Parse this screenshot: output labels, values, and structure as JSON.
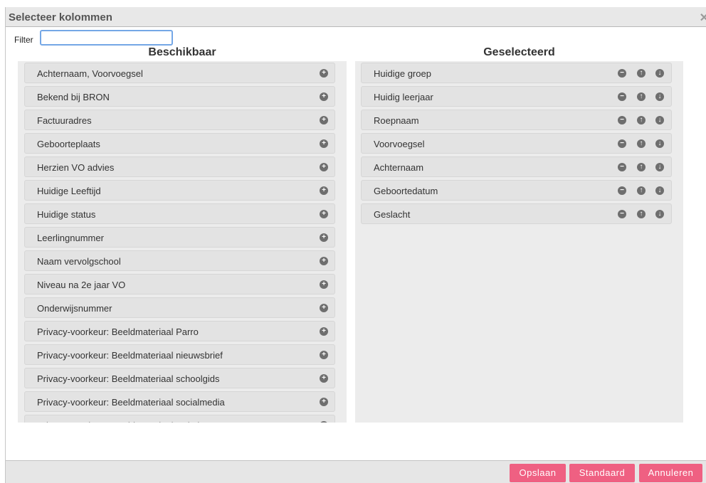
{
  "dialog": {
    "title": "Selecteer kolommen",
    "close_symbol": "✕"
  },
  "filter": {
    "label": "Filter",
    "value": ""
  },
  "available": {
    "heading": "Beschikbaar",
    "add_icon": "plus-circle-icon",
    "items": [
      {
        "label": "Achternaam, Voorvoegsel"
      },
      {
        "label": "Bekend bij BRON"
      },
      {
        "label": "Factuuradres"
      },
      {
        "label": "Geboorteplaats"
      },
      {
        "label": "Herzien VO advies"
      },
      {
        "label": "Huidige Leeftijd"
      },
      {
        "label": "Huidige status"
      },
      {
        "label": "Leerlingnummer"
      },
      {
        "label": "Naam vervolgschool"
      },
      {
        "label": "Niveau na 2e jaar VO"
      },
      {
        "label": "Onderwijsnummer"
      },
      {
        "label": "Privacy-voorkeur: Beeldmateriaal Parro"
      },
      {
        "label": "Privacy-voorkeur: Beeldmateriaal nieuwsbrief"
      },
      {
        "label": "Privacy-voorkeur: Beeldmateriaal schoolgids"
      },
      {
        "label": "Privacy-voorkeur: Beeldmateriaal socialmedia"
      },
      {
        "label": "Privacy-voorkeur: Beeldmateriaal website"
      }
    ]
  },
  "selected": {
    "heading": "Geselecteerd",
    "remove_icon": "minus-circle-icon",
    "up_icon": "arrow-up-circle-icon",
    "down_icon": "arrow-down-circle-icon",
    "items": [
      {
        "label": "Huidige groep"
      },
      {
        "label": "Huidig leerjaar"
      },
      {
        "label": "Roepnaam"
      },
      {
        "label": "Voorvoegsel"
      },
      {
        "label": "Achternaam"
      },
      {
        "label": "Geboortedatum"
      },
      {
        "label": "Geslacht"
      }
    ]
  },
  "footer": {
    "save_label": "Opslaan",
    "default_label": "Standaard",
    "cancel_label": "Annuleren"
  },
  "colors": {
    "button": "#ef6082",
    "focus_border": "#74a7e6"
  }
}
